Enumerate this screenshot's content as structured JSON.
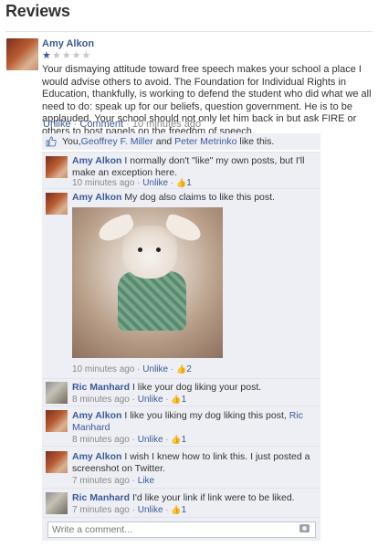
{
  "page": {
    "title": "Reviews"
  },
  "review": {
    "author": "Amy Alkon",
    "rating": 1,
    "rating_max": 5,
    "text": "Your dismaying attitude toward free speech makes your school a place I would advise others to avoid. The Foundation for Individual Rights in Education, thankfully, is working to defend the student who did what we all need to do: speak up for our beliefs, question government. He is to be applauded. Your school should not only let him back in but ask FIRE or others to host panels on the freedom of speech.",
    "actions": {
      "unlike": "Unlike",
      "sep": "·",
      "comment": "Comment",
      "time": "10 minutes ago"
    }
  },
  "likes": {
    "you": "You, ",
    "person1": "Geoffrey F. Miller",
    "and": " and ",
    "person2": "Peter Metrinko",
    "suffix": " like this."
  },
  "comments": [
    {
      "author": "Amy Alkon",
      "text": "I normally don't \"like\" my own posts, but I'll make an exception here.",
      "time": "10 minutes ago",
      "action": "Unlike",
      "likes": "1",
      "avatar": "amy"
    },
    {
      "author": "Amy Alkon",
      "text": "My dog also claims to like this post.",
      "time": "10 minutes ago",
      "action": "Unlike",
      "likes": "2",
      "avatar": "amy",
      "has_image": true
    },
    {
      "author": "Ric Manhard",
      "text": "I like your dog liking your post.",
      "time": "8 minutes ago",
      "action": "Unlike",
      "likes": "1",
      "avatar": "ric"
    },
    {
      "author": "Amy Alkon",
      "text": "I like you liking my dog liking this post, ",
      "mention": "Ric Manhard",
      "time": "8 minutes ago",
      "action": "Unlike",
      "likes": "1",
      "avatar": "amy"
    },
    {
      "author": "Amy Alkon",
      "text": "I wish I knew how to link this. I just posted a screenshot on Twitter.",
      "time": "7 minutes ago",
      "action": "Like",
      "likes": "",
      "avatar": "amy"
    },
    {
      "author": "Ric Manhard",
      "text": "I'd like your link if link were to be liked.",
      "time": "7 minutes ago",
      "action": "Unlike",
      "likes": "1",
      "avatar": "ric"
    }
  ],
  "composer": {
    "placeholder": "Write a comment..."
  },
  "icons": {
    "thumb": "thumbs-up-icon",
    "camera": "camera-icon",
    "star": "star-icon"
  },
  "colors": {
    "link": "#3b5998",
    "comment_bg": "#edeff4",
    "meta": "#888888"
  }
}
